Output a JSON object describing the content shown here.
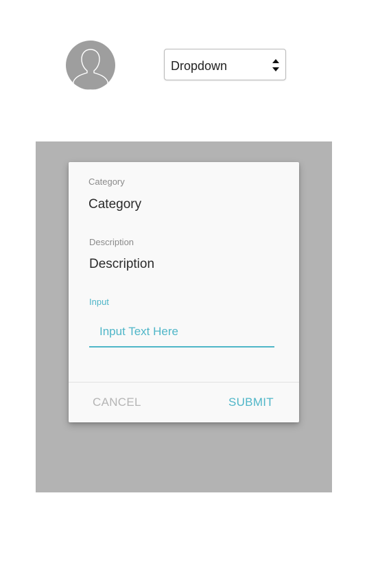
{
  "avatar": {
    "icon": "user-silhouette-icon",
    "bg_color": "#9e9e9e"
  },
  "dropdown": {
    "selected": "Dropdown",
    "icon": "up-down-arrows-icon"
  },
  "dialog": {
    "category_caption": "Category",
    "category_value": "Category",
    "description_caption": "Description",
    "description_value": "Description",
    "input_caption": "Input",
    "input_value": "",
    "input_placeholder": "Input Text Here",
    "cancel_label": "CANCEL",
    "submit_label": "SUBMIT"
  },
  "colors": {
    "accent": "#4fb6c8",
    "overlay": "#b3b3b3",
    "dialog_bg": "#f9f9f9",
    "muted_text": "#b5b5b5"
  }
}
